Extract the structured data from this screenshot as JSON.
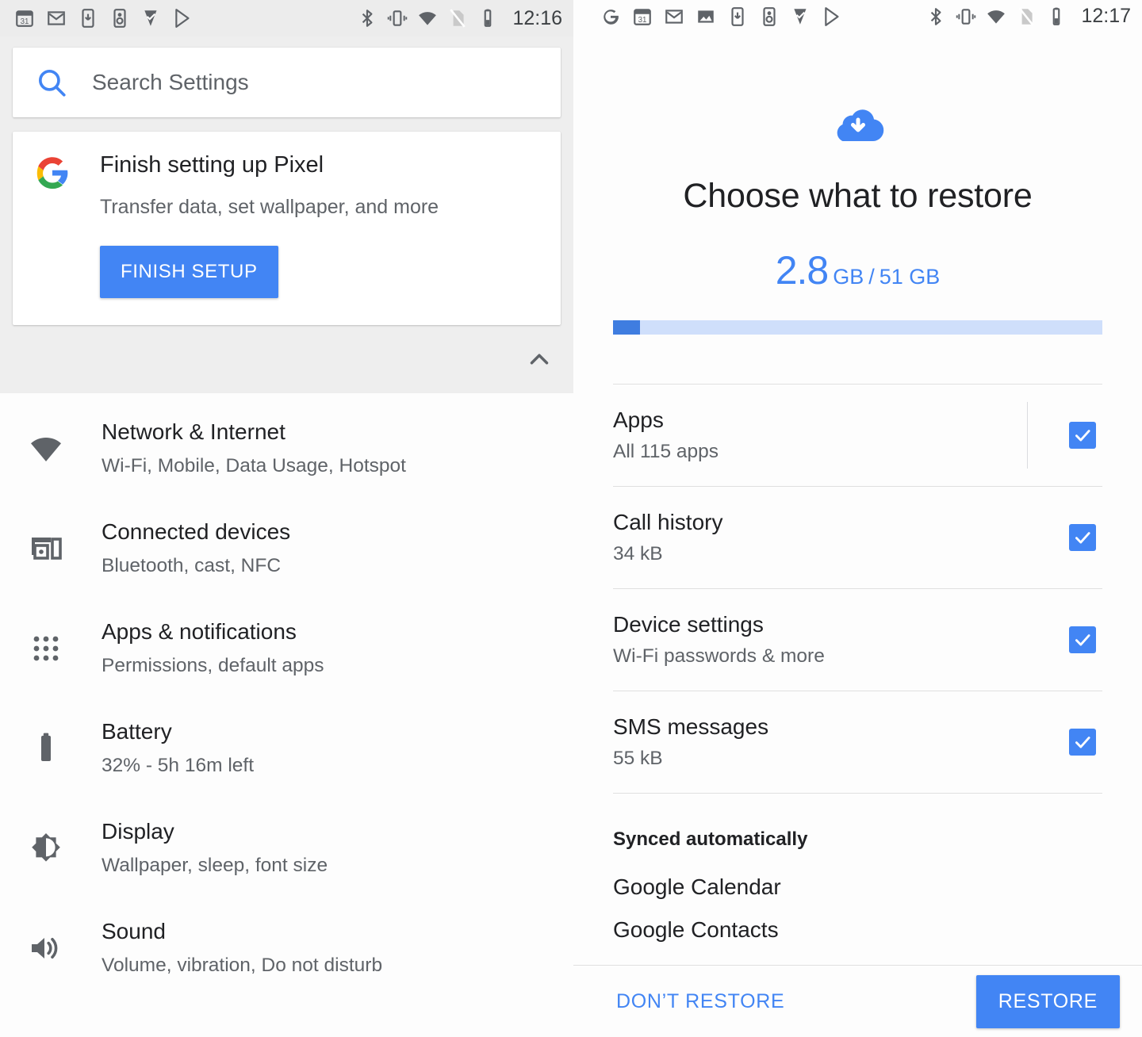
{
  "left_panel": {
    "status_bar": {
      "time": "12:16",
      "left_icons": [
        "calendar-icon",
        "gmail-icon",
        "download-icon",
        "podcast-icon",
        "tasks-icon",
        "play-store-icon"
      ],
      "right_icons": [
        "bluetooth-icon",
        "vibrate-icon",
        "wifi-icon",
        "no-sim-icon",
        "battery-icon"
      ]
    },
    "search": {
      "placeholder": "Search Settings",
      "icon": "search-icon"
    },
    "setup_card": {
      "logo": "google-g-logo",
      "title": "Finish setting up Pixel",
      "subtitle": "Transfer data, set wallpaper, and more",
      "button_label": "FINISH SETUP",
      "collapse_icon": "chevron-up-icon"
    },
    "settings_items": [
      {
        "icon": "wifi-icon",
        "title": "Network & Internet",
        "subtitle": "Wi-Fi, Mobile, Data Usage, Hotspot"
      },
      {
        "icon": "connected-devices-icon",
        "title": "Connected devices",
        "subtitle": "Bluetooth, cast, NFC"
      },
      {
        "icon": "apps-grid-icon",
        "title": "Apps & notifications",
        "subtitle": "Permissions, default apps"
      },
      {
        "icon": "battery-icon",
        "title": "Battery",
        "subtitle": "32% - 5h 16m left"
      },
      {
        "icon": "brightness-icon",
        "title": "Display",
        "subtitle": "Wallpaper, sleep, font size"
      },
      {
        "icon": "volume-icon",
        "title": "Sound",
        "subtitle": "Volume, vibration, Do not disturb"
      }
    ]
  },
  "right_panel": {
    "status_bar": {
      "time": "12:17",
      "left_icons": [
        "google-icon",
        "calendar-icon",
        "gmail-icon",
        "photos-icon",
        "download-icon",
        "podcast-icon",
        "tasks-icon",
        "play-store-icon"
      ],
      "right_icons": [
        "bluetooth-icon",
        "vibrate-icon",
        "wifi-icon",
        "no-sim-icon",
        "battery-icon"
      ]
    },
    "header_icon": "cloud-download-icon",
    "title": "Choose what to restore",
    "usage": {
      "used": "2.8",
      "used_unit": "GB",
      "separator": "/",
      "total": "51 GB",
      "progress_percent": 5.5,
      "accent_color": "#4285f4",
      "track_color": "#cfdffb"
    },
    "restore_items": [
      {
        "title": "Apps",
        "subtitle": "All 115 apps",
        "checked": true,
        "has_divider": true
      },
      {
        "title": "Call history",
        "subtitle": "34 kB",
        "checked": true,
        "has_divider": false
      },
      {
        "title": "Device settings",
        "subtitle": "Wi-Fi passwords & more",
        "checked": true,
        "has_divider": false
      },
      {
        "title": "SMS messages",
        "subtitle": "55 kB",
        "checked": true,
        "has_divider": false
      }
    ],
    "synced_section": {
      "heading": "Synced automatically",
      "items": [
        "Google Calendar",
        "Google Contacts"
      ]
    },
    "footer": {
      "secondary_label": "DON’T RESTORE",
      "primary_label": "RESTORE"
    }
  }
}
